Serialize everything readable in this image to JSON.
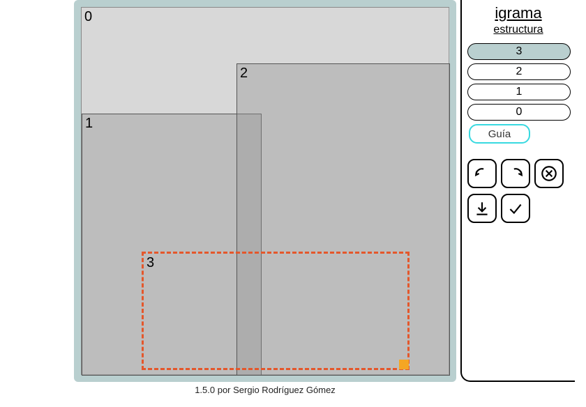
{
  "brand": "igrama",
  "subhead": "estructura",
  "layers": [
    "3",
    "2",
    "1",
    "0"
  ],
  "selected_layer_index": 0,
  "guide_label": "Guía",
  "footer": "1.5.0 por Sergio Rodríguez Gómez",
  "rects": {
    "r0": "0",
    "r1": "1",
    "r2": "2",
    "r3": "3"
  }
}
